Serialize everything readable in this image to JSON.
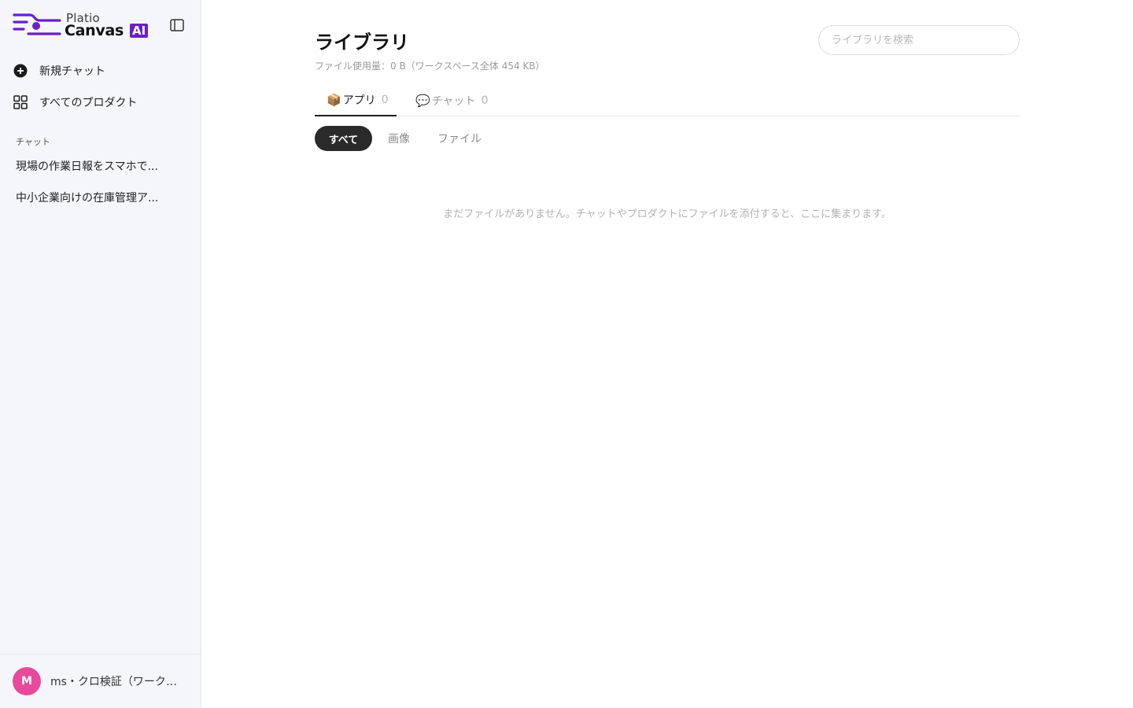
{
  "brand": {
    "name_small": "Platio",
    "name_big": "Canvas",
    "badge": "AI",
    "accent_color": "#6a1fc9"
  },
  "sidebar": {
    "nav": [
      {
        "label": "新規チャット",
        "icon": "plus-circle-icon"
      },
      {
        "label": "すべてのプロダクト",
        "icon": "grid-icon"
      }
    ],
    "section_label": "チャット",
    "chats": [
      {
        "label": "現場の作業日報をスマホで..."
      },
      {
        "label": "中小企業向けの在庫管理ア..."
      }
    ],
    "user": {
      "initial": "M",
      "name": "ms・クロ検証（ワークシ...",
      "avatar_color": "#e8499c"
    }
  },
  "main": {
    "title": "ライブラリ",
    "usage": "ファイル使用量：0 B（ワークスペース全体 454 KB）",
    "search_placeholder": "ライブラリを検索",
    "tabs": [
      {
        "emoji": "📦",
        "label": "アプリ",
        "count": "0",
        "active": true
      },
      {
        "emoji": "💬",
        "label": "チャット",
        "count": "0",
        "active": false
      }
    ],
    "filters": [
      {
        "label": "すべて",
        "active": true
      },
      {
        "label": "画像",
        "active": false
      },
      {
        "label": "ファイル",
        "active": false
      }
    ],
    "empty_message": "まだファイルがありません。チャットやプロダクトにファイルを添付すると、ここに集まります。"
  }
}
